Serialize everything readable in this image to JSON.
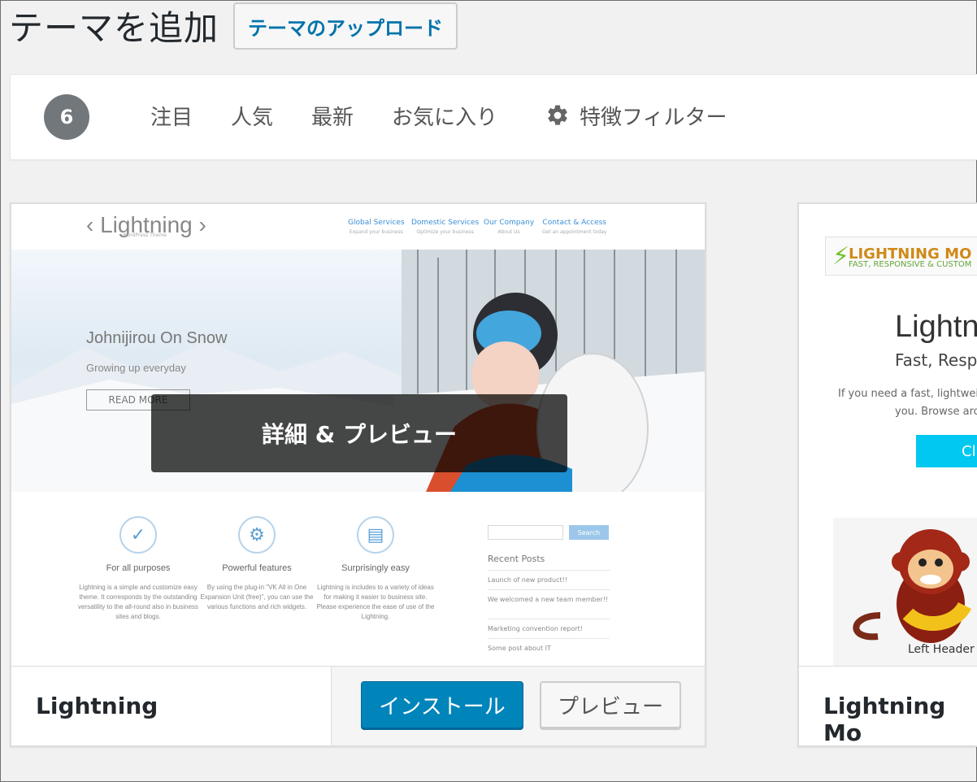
{
  "page": {
    "title": "テーマを追加",
    "upload_button": "テーマのアップロード"
  },
  "filter_bar": {
    "count": "6",
    "links": [
      "注目",
      "人気",
      "最新",
      "お気に入り"
    ],
    "feature_filter": "特徴フィルター"
  },
  "themes": [
    {
      "name": "Lightning",
      "install_label": "インストール",
      "preview_label": "プレビュー",
      "details_overlay": "詳細 & プレビュー",
      "screenshot": {
        "logo": "‹ Lightning ›",
        "logo_sub": "WordPress Theme",
        "nav": [
          {
            "label": "Global Services",
            "sub": "Expand your business"
          },
          {
            "label": "Domestic Services",
            "sub": "Optimize your business"
          },
          {
            "label": "Our Company",
            "sub": "About Us"
          },
          {
            "label": "Contact & Access",
            "sub": "Get an appointment today"
          }
        ],
        "hero_title": "Johnijirou On Snow",
        "hero_subtitle": "Growing up everyday",
        "hero_button": "READ MORE",
        "features": [
          {
            "icon": "check-icon",
            "title": "For all purposes",
            "text": "Lightning is a simple and customize easy theme. It corresponds by the outstanding versatility to the all-round also in business sites and blogs."
          },
          {
            "icon": "gears-icon",
            "title": "Powerful features",
            "text": "By using the plug-in \"VK All in One Expansion Unit (free)\", you can use the various functions and rich widgets."
          },
          {
            "icon": "document-icon",
            "title": "Surprisingly easy",
            "text": "Lightning is includes to a variety of ideas for making it easier to business site. Please experience the ease of use of the Lightning."
          }
        ],
        "search_button": "Search",
        "recent_posts_title": "Recent Posts",
        "recent_posts": [
          "Launch of new product!!",
          "We welcomed a new team member!!",
          "Marketing convention report!",
          "Some post about IT"
        ]
      }
    },
    {
      "name": "Lightning Mo",
      "screenshot": {
        "logo": "LIGHTNING MO",
        "logo_sub": "FAST, RESPONSIVE & CUSTOM",
        "title": "Lightnin",
        "subtitle": "Fast, Responsive",
        "text_line1": "If you need a fast, lightweight theme",
        "text_line2": "you. Browse around t",
        "cta": "Cli",
        "panel_header": "Left Header"
      }
    }
  ]
}
